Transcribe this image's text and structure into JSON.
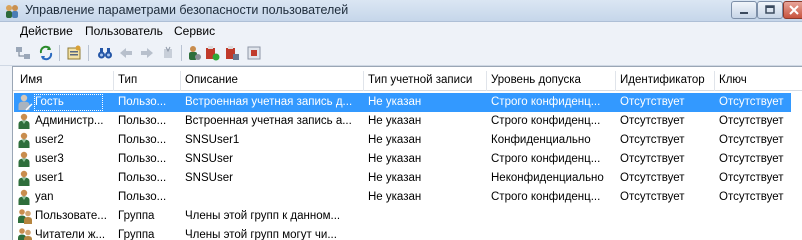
{
  "window": {
    "title": "Управление параметрами безопасности пользователей"
  },
  "menu": [
    "Действие",
    "Пользователь",
    "Сервис"
  ],
  "columns": [
    "Имя",
    "Тип",
    "Описание",
    "Тип учетной записи",
    "Уровень допуска",
    "Идентификатор",
    "Ключ"
  ],
  "rows": [
    {
      "icon": "guest-user-icon",
      "name": "Гость",
      "type": "Пользо...",
      "desc": "Встроенная учетная запись д...",
      "account": "Не указан",
      "level": "Строго конфиденц...",
      "id": "Отсутствует",
      "key": "Отсутствует",
      "selected": true
    },
    {
      "icon": "user-icon",
      "name": "Администр...",
      "type": "Пользо...",
      "desc": "Встроенная учетная запись а...",
      "account": "Не указан",
      "level": "Строго конфиденц...",
      "id": "Отсутствует",
      "key": "Отсутствует"
    },
    {
      "icon": "user-icon",
      "name": "user2",
      "type": "Пользо...",
      "desc": "SNSUser1",
      "account": "Не указан",
      "level": "Конфиденциально",
      "id": "Отсутствует",
      "key": "Отсутствует"
    },
    {
      "icon": "user-icon",
      "name": "user3",
      "type": "Пользо...",
      "desc": "SNSUser",
      "account": "Не указан",
      "level": "Строго конфиденц...",
      "id": "Отсутствует",
      "key": "Отсутствует"
    },
    {
      "icon": "user-icon",
      "name": "user1",
      "type": "Пользо...",
      "desc": "SNSUser",
      "account": "Не указан",
      "level": "Неконфиденциально",
      "id": "Отсутствует",
      "key": "Отсутствует"
    },
    {
      "icon": "user-icon",
      "name": "yan",
      "type": "Пользо...",
      "desc": "",
      "account": "Не указан",
      "level": "Строго конфиденц...",
      "id": "Отсутствует",
      "key": "Отсутствует"
    },
    {
      "icon": "group-icon",
      "name": "Пользовате...",
      "type": "Группа",
      "desc": "Члены этой групп к данном...",
      "account": "",
      "level": "",
      "id": "",
      "key": ""
    },
    {
      "icon": "group-icon",
      "name": "Читатели ж...",
      "type": "Группа",
      "desc": "Члены этой групп могут чи...",
      "account": "",
      "level": "",
      "id": "",
      "key": ""
    }
  ],
  "colors": {
    "selection": "#3399ff",
    "titlebar": "#c6d6ea",
    "chrome": "#eef2f8"
  }
}
